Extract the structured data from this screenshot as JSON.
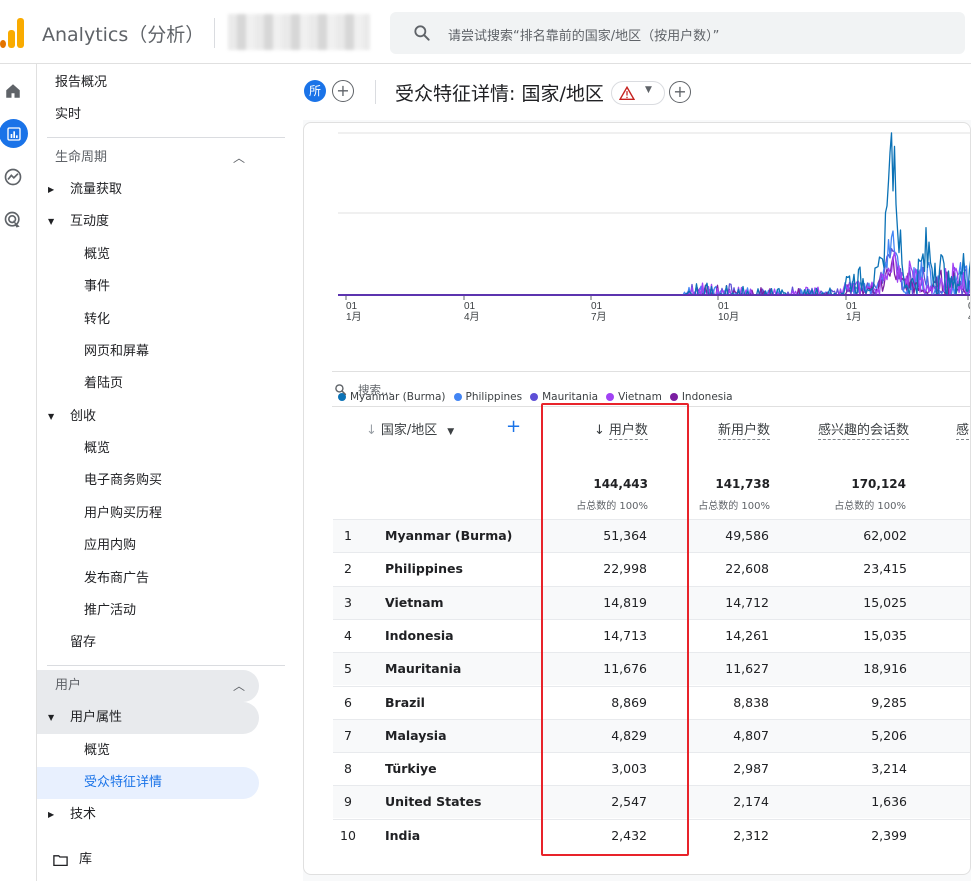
{
  "app": {
    "title": "Analytics（分析）"
  },
  "search": {
    "placeholder": "请尝试搜索“排名靠前的国家/地区（按用户数）”"
  },
  "nav": {
    "report_overview": "报告概况",
    "realtime": "实时",
    "lifecycle": "生命周期",
    "acquisition": "流量获取",
    "engagement": "互动度",
    "engagement_items": [
      "概览",
      "事件",
      "转化",
      "网页和屏幕",
      "着陆页"
    ],
    "monetization": "创收",
    "monetization_items": [
      "概览",
      "电子商务购买",
      "用户购买历程",
      "应用内购",
      "发布商广告",
      "推广活动"
    ],
    "retention": "留存",
    "user_section": "用户",
    "user_attributes": "用户属性",
    "user_attr_items": [
      "概览",
      "受众特征详情"
    ],
    "tech": "技术",
    "library": "库"
  },
  "header": {
    "all_badge": "所",
    "title": "受众特征详情: 国家/地区"
  },
  "chart_data": {
    "type": "line",
    "x_tick_labels": [
      {
        "day": "01",
        "month": "1月"
      },
      {
        "day": "01",
        "month": "4月"
      },
      {
        "day": "01",
        "month": "7月"
      },
      {
        "day": "01",
        "month": "10月"
      },
      {
        "day": "01",
        "month": "1月"
      },
      {
        "day": "0",
        "month": "4月"
      }
    ],
    "series": [
      {
        "name": "Myanmar (Burma)",
        "color": "#0b72b6"
      },
      {
        "name": "Philippines",
        "color": "#4285f4"
      },
      {
        "name": "Mauritania",
        "color": "#5e4fd6"
      },
      {
        "name": "Vietnam",
        "color": "#a142f4"
      },
      {
        "name": "Indonesia",
        "color": "#7b1fa2"
      }
    ],
    "grid": true
  },
  "table": {
    "search_placeholder": "搜索...",
    "dimension_header": "国家/地区",
    "columns": [
      "用户数",
      "新用户数",
      "感兴趣的会话数",
      "感"
    ],
    "totals": [
      "144,443",
      "141,738",
      "170,124"
    ],
    "totals_sub": [
      "占总数的 100%",
      "占总数的 100%",
      "占总数的 100%"
    ],
    "rows": [
      {
        "rank": "1",
        "country": "Myanmar (Burma)",
        "users": "51,364",
        "new_users": "49,586",
        "engaged": "62,002"
      },
      {
        "rank": "2",
        "country": "Philippines",
        "users": "22,998",
        "new_users": "22,608",
        "engaged": "23,415"
      },
      {
        "rank": "3",
        "country": "Vietnam",
        "users": "14,819",
        "new_users": "14,712",
        "engaged": "15,025"
      },
      {
        "rank": "4",
        "country": "Indonesia",
        "users": "14,713",
        "new_users": "14,261",
        "engaged": "15,035"
      },
      {
        "rank": "5",
        "country": "Mauritania",
        "users": "11,676",
        "new_users": "11,627",
        "engaged": "18,916"
      },
      {
        "rank": "6",
        "country": "Brazil",
        "users": "8,869",
        "new_users": "8,838",
        "engaged": "9,285"
      },
      {
        "rank": "7",
        "country": "Malaysia",
        "users": "4,829",
        "new_users": "4,807",
        "engaged": "5,206"
      },
      {
        "rank": "8",
        "country": "Türkiye",
        "users": "3,003",
        "new_users": "2,987",
        "engaged": "3,214"
      },
      {
        "rank": "9",
        "country": "United States",
        "users": "2,547",
        "new_users": "2,174",
        "engaged": "1,636"
      },
      {
        "rank": "10",
        "country": "India",
        "users": "2,432",
        "new_users": "2,312",
        "engaged": "2,399"
      }
    ]
  },
  "colors": {
    "accent": "#1a73e8",
    "highlight_box": "#e8232a"
  }
}
